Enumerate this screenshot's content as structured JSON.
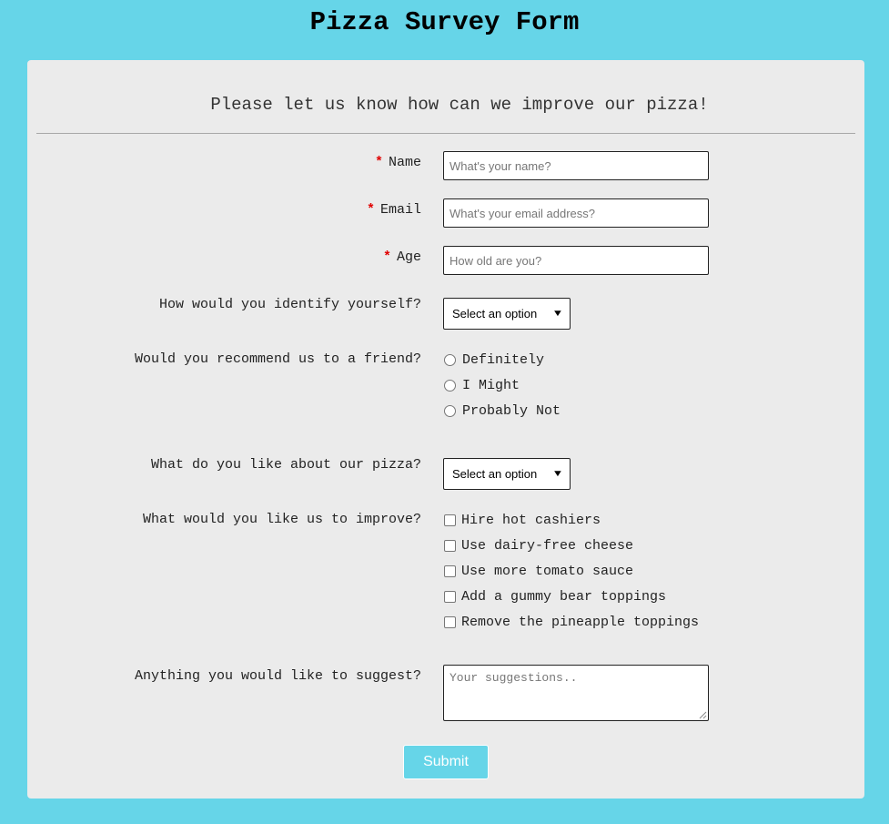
{
  "page": {
    "title": "Pizza Survey Form",
    "background_color": "#66d5e8"
  },
  "form": {
    "subtitle": "Please let us know how can we improve our pizza!",
    "required_marker": "*",
    "name": {
      "label": "Name",
      "placeholder": "What's your name?",
      "value": ""
    },
    "email": {
      "label": "Email",
      "placeholder": "What's your email address?",
      "value": ""
    },
    "age": {
      "label": "Age",
      "placeholder": "How old are you?",
      "value": ""
    },
    "identify": {
      "label": "How would you identify yourself?",
      "selected": "Select an option"
    },
    "recommend": {
      "label": "Would you recommend us to a friend?",
      "options": [
        "Definitely",
        "I Might",
        "Probably Not"
      ]
    },
    "like": {
      "label": "What do you like about our pizza?",
      "selected": "Select an option"
    },
    "improve": {
      "label": "What would you like us to improve?",
      "options": [
        "Hire hot cashiers",
        "Use dairy-free cheese",
        "Use more tomato sauce",
        "Add a gummy bear toppings",
        "Remove the pineapple toppings"
      ]
    },
    "suggest": {
      "label": "Anything you would like to suggest?",
      "placeholder": "Your suggestions..",
      "value": ""
    },
    "submit_label": "Submit"
  }
}
